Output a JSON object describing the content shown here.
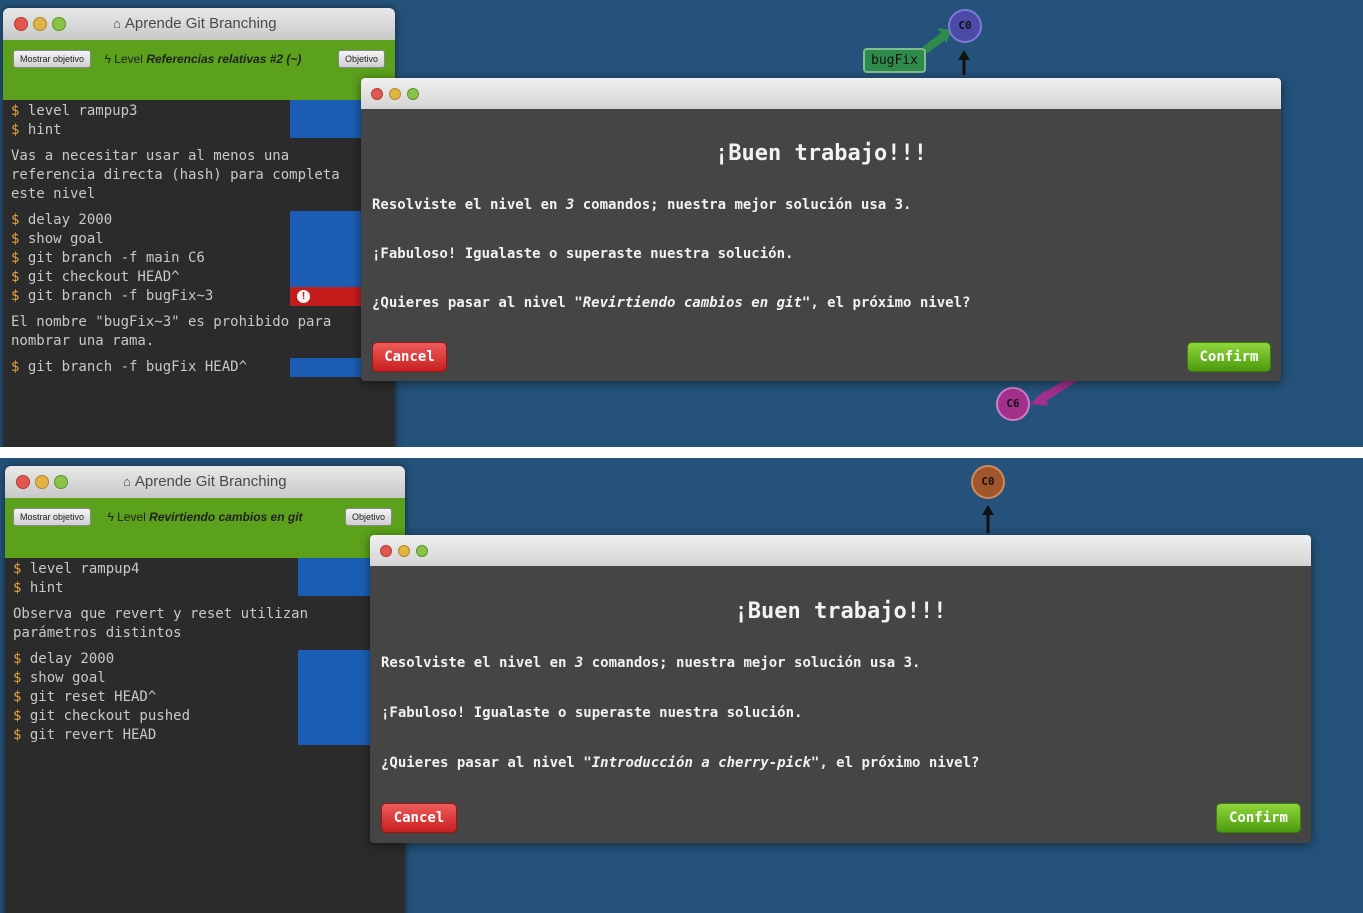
{
  "colors": {
    "canvas": "#24527a",
    "terminal": "#2b2b2b",
    "level_bar": "#5ba11b",
    "prompt": "#e8a33d",
    "command_block": "#1b5db5",
    "error": "#c41b1b",
    "modal": "#454545",
    "cancel": "#d83434",
    "confirm": "#6fbc22"
  },
  "panels": [
    {
      "terminal": {
        "title": "Aprende Git Branching",
        "show_goal_button": "Mostrar objetivo",
        "level_prefix": "Level",
        "level_name": "Referencias relativas #2 (~)",
        "goal_button": "Objetivo",
        "lines": {
          "l1": "level rampup3",
          "l2": "hint",
          "hint_text": "Vas a necesitar usar al menos una\nreferencia directa (hash) para completa\neste nivel",
          "l3": "delay 2000",
          "l4": "show goal",
          "l5": "git branch -f main C6",
          "l6": "git checkout HEAD^",
          "l7": "git branch -f bugFix~3",
          "error_text": "El nombre \"bugFix~3\" es prohibido para\nnombrar una rama.",
          "l8": "git branch -f bugFix HEAD^"
        }
      },
      "graph": {
        "node_top": "C0",
        "branch": "bugFix",
        "node_bottom": "C6"
      },
      "modal": {
        "heading": "¡Buen trabajo!!!",
        "p1_before": "Resolviste el nivel en ",
        "p1_count": "3",
        "p1_after": " comandos; nuestra mejor solución usa 3.",
        "p2": "¡Fabuloso! Igualaste o superaste nuestra solución.",
        "p3_before": "¿Quieres pasar al nivel ",
        "p3_level": "\"Revirtiendo cambios en git\"",
        "p3_after": ", el próximo nivel?",
        "cancel": "Cancel",
        "confirm": "Confirm"
      }
    },
    {
      "terminal": {
        "title": "Aprende Git Branching",
        "show_goal_button": "Mostrar objetivo",
        "level_prefix": "Level",
        "level_name": "Revirtiendo cambios en git",
        "goal_button": "Objetivo",
        "lines": {
          "l1": "level rampup4",
          "l2": "hint",
          "hint_text": "Observa que revert y reset utilizan\nparámetros distintos",
          "l3": "delay 2000",
          "l4": "show goal",
          "l5": "git reset HEAD^",
          "l6": "git checkout pushed",
          "l7": "git revert HEAD"
        }
      },
      "graph": {
        "node_top": "C0"
      },
      "modal": {
        "heading": "¡Buen trabajo!!!",
        "p1_before": "Resolviste el nivel en ",
        "p1_count": "3",
        "p1_after": " comandos; nuestra mejor solución usa 3.",
        "p2": "¡Fabuloso! Igualaste o superaste nuestra solución.",
        "p3_before": "¿Quieres pasar al nivel ",
        "p3_level": "\"Introducción a cherry-pick\"",
        "p3_after": ", el próximo nivel?",
        "cancel": "Cancel",
        "confirm": "Confirm"
      }
    }
  ]
}
